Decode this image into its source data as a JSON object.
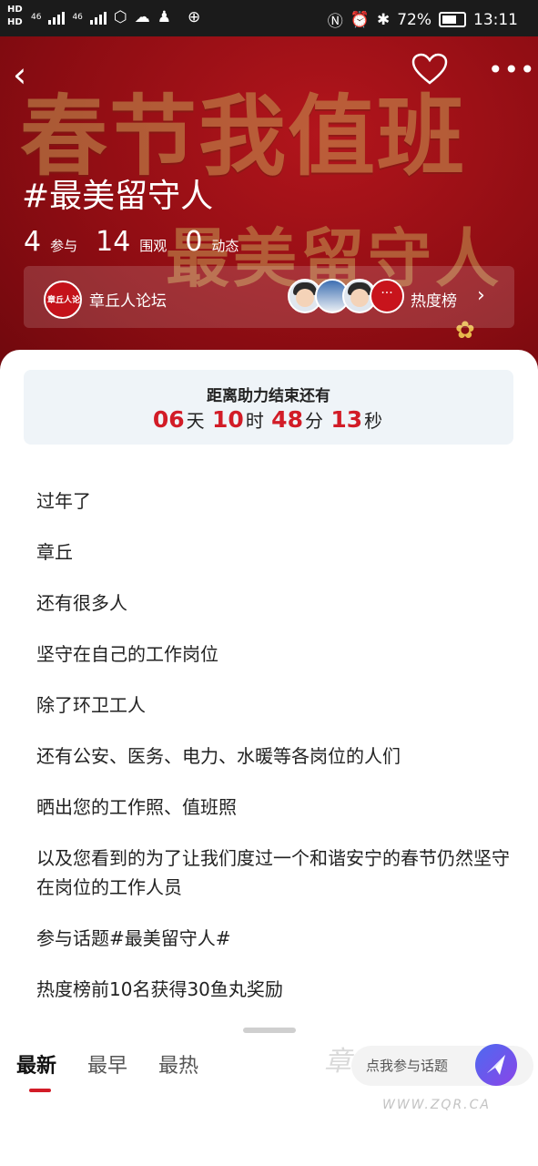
{
  "status_bar": {
    "hd_top": "HD",
    "hd_bottom": "HD",
    "net1": "46",
    "net2": "46",
    "battery": "72%",
    "time": "13:11"
  },
  "hero": {
    "banner_line1": "春节我值班",
    "banner_line2": "最美留守人",
    "topic_title": "#最美留守人",
    "stats": [
      {
        "value": "4",
        "label": "参与"
      },
      {
        "value": "14",
        "label": "围观"
      },
      {
        "value": "0",
        "label": "动态"
      }
    ],
    "forum_logo_text": "章丘人论坛",
    "forum_name": "章丘人论坛",
    "more_dot": "···",
    "rank_label": "热度榜"
  },
  "countdown": {
    "title": "距离助力结束还有",
    "days": "06",
    "days_unit": "天",
    "hours": "10",
    "hours_unit": "时",
    "minutes": "48",
    "minutes_unit": "分",
    "seconds": "13",
    "seconds_unit": "秒"
  },
  "description": [
    "过年了",
    "章丘",
    "还有很多人",
    "坚守在自己的工作岗位",
    "除了环卫工人",
    "还有公安、医务、电力、水暖等各岗位的人们",
    "晒出您的工作照、值班照",
    "以及您看到的为了让我们度过一个和谐安宁的春节仍然坚守在岗位的工作人员",
    "参与话题#最美留守人#",
    "热度榜前10名获得30鱼丸奖励"
  ],
  "tabs": [
    "最新",
    "最早",
    "最热"
  ],
  "join_text": "点我参与话题",
  "watermark": "章丘人论坛",
  "watermark_url": "WWW.ZQR.CA",
  "colors": {
    "accent_red": "#d21c27",
    "hero_bg": "#a3121a",
    "join_gradient_start": "#4d6af0",
    "join_gradient_end": "#8a45e8"
  }
}
